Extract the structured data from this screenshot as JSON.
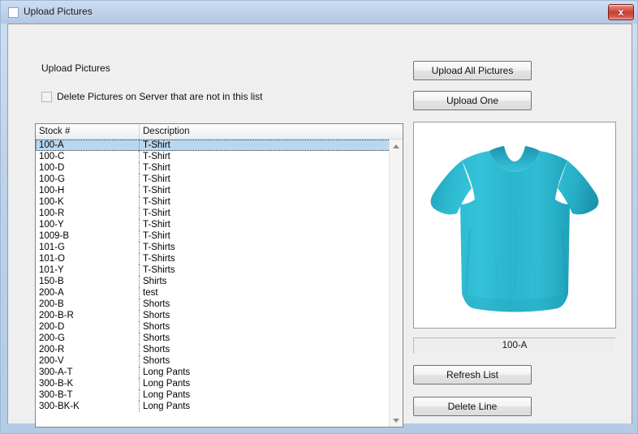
{
  "window": {
    "title": "Upload Pictures",
    "icon": "window-icon",
    "close_label": "x"
  },
  "form": {
    "heading": "Upload Pictures",
    "delete_checkbox": {
      "label": "Delete Pictures on Server that are not in this list",
      "checked": false
    }
  },
  "list": {
    "columns": [
      "Stock #",
      "Description"
    ],
    "selected_index": 0,
    "rows": [
      {
        "stock": "100-A",
        "description": "T-Shirt"
      },
      {
        "stock": "100-C",
        "description": "T-Shirt"
      },
      {
        "stock": "100-D",
        "description": "T-Shirt"
      },
      {
        "stock": "100-G",
        "description": "T-Shirt"
      },
      {
        "stock": "100-H",
        "description": "T-Shirt"
      },
      {
        "stock": "100-K",
        "description": "T-Shirt"
      },
      {
        "stock": "100-R",
        "description": "T-Shirt"
      },
      {
        "stock": "100-Y",
        "description": "T-Shirt"
      },
      {
        "stock": "1009-B",
        "description": "T-Shirt"
      },
      {
        "stock": "101-G",
        "description": "T-Shirts"
      },
      {
        "stock": "101-O",
        "description": "T-Shirts"
      },
      {
        "stock": "101-Y",
        "description": "T-Shirts"
      },
      {
        "stock": "150-B",
        "description": "Shirts"
      },
      {
        "stock": "200-A",
        "description": "test"
      },
      {
        "stock": "200-B",
        "description": "Shorts"
      },
      {
        "stock": "200-B-R",
        "description": "Shorts"
      },
      {
        "stock": "200-D",
        "description": "Shorts"
      },
      {
        "stock": "200-G",
        "description": "Shorts"
      },
      {
        "stock": "200-R",
        "description": "Shorts"
      },
      {
        "stock": "200-V",
        "description": "Shorts"
      },
      {
        "stock": "300-A-T",
        "description": "Long Pants"
      },
      {
        "stock": "300-B-K",
        "description": "Long Pants"
      },
      {
        "stock": "300-B-T",
        "description": "Long Pants"
      },
      {
        "stock": "300-BK-K",
        "description": "Long Pants"
      }
    ]
  },
  "buttons": {
    "upload_all": "Upload All Pictures",
    "upload_one": "Upload One",
    "refresh_list": "Refresh List",
    "delete_line": "Delete Line"
  },
  "preview": {
    "stock_label": "100-A",
    "image_alt": "tshirt-image",
    "shirt_color": "#2ab6ce",
    "shirt_shade": "#1f9fb8",
    "shirt_light": "#44c8dd"
  },
  "colors": {
    "titlebar": "#bdd2ea",
    "client_bg": "#efefef",
    "selection": "#b9d8f0",
    "close_red": "#c63f32"
  }
}
